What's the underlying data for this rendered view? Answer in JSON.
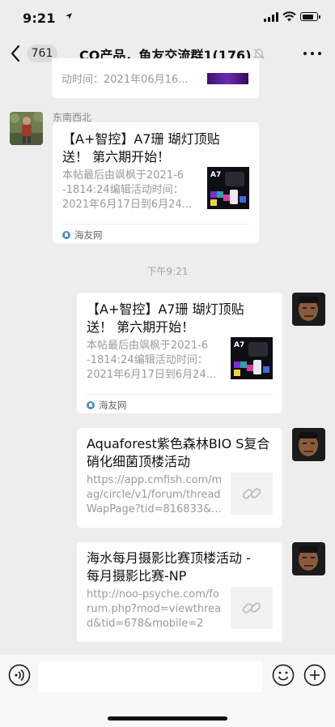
{
  "status": {
    "time": "9:21"
  },
  "nav": {
    "unread_count": "761",
    "title": "CO产品，鱼友交流群1(176)"
  },
  "chat": {
    "partial_top": {
      "desc_tail": "动时间：2021年06月16..."
    },
    "message_1": {
      "sender": "东南西北",
      "title_l1": "【A+智控】A7珊 瑚灯顶贴",
      "title_l2": "送！ 第六期开始！",
      "desc_l1": "本帖最后由飒枫于2021-6",
      "desc_l2": "-1814:24编辑活动时间：",
      "desc_l3": "2021年6月17日到6月24...",
      "thumb_text": "A7",
      "source": "海友网"
    },
    "timestamp": "下午9:21",
    "message_2": {
      "title_l1": "【A+智控】A7珊 瑚灯顶贴",
      "title_l2": "送！ 第六期开始！",
      "desc_l1": "本帖最后由飒枫于2021-6",
      "desc_l2": "-1814:24编辑活动时间：",
      "desc_l3": "2021年6月17日到6月24...",
      "thumb_text": "A7",
      "source": "海友网"
    },
    "message_3": {
      "title_l1": "Aquaforest紫色森林BIO S复合",
      "title_l2": "硝化细菌顶楼活动",
      "url_l1": "https://app.cmfish.com/m",
      "url_l2": "ag/circle/v1/forum/thread",
      "url_l3": "WapPage?tid=816833&..."
    },
    "message_4": {
      "title_l1": "海水每月摄影比赛顶楼活动 -",
      "title_l2": "每月摄影比赛-NP",
      "url_l1": "http://noo-psyche.com/fo",
      "url_l2": "rum.php?mod=viewthrea",
      "url_l3": "d&tid=678&mobile=2"
    }
  },
  "colors": {
    "background": "#ededed",
    "bubble": "#ffffff",
    "muted_text": "#9a9a9a"
  }
}
